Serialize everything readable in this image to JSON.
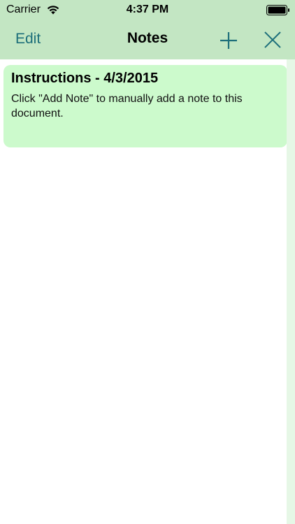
{
  "status_bar": {
    "carrier": "Carrier",
    "time": "4:37 PM",
    "wifi_icon": "wifi-icon",
    "battery_icon": "battery-full-icon"
  },
  "nav": {
    "edit_label": "Edit",
    "title": "Notes",
    "add_icon": "plus-icon",
    "close_icon": "close-icon"
  },
  "notes": [
    {
      "title": "Instructions - 4/3/2015",
      "body": "Click \"Add Note\" to manually add a note to this document."
    }
  ],
  "colors": {
    "header_bg": "#c3e6c3",
    "accent": "#1d6f7a",
    "note_bg": "#ccfacc",
    "side_strip": "#e6f7e6"
  }
}
